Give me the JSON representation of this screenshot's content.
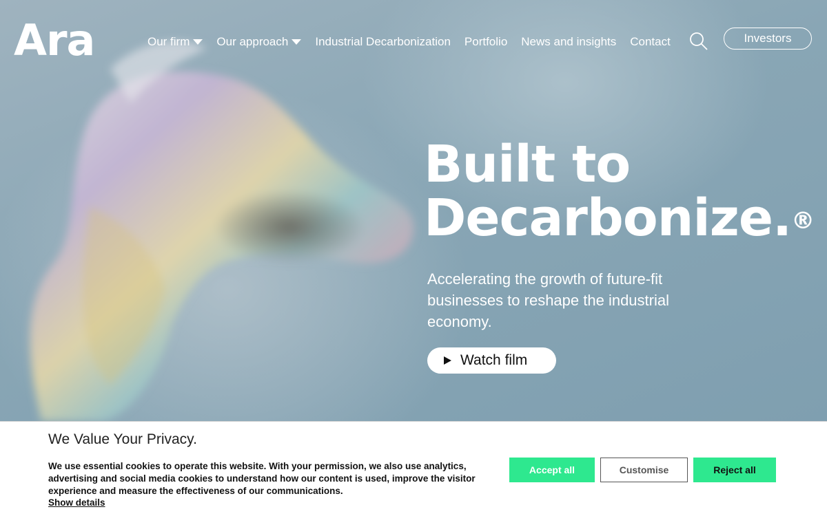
{
  "brand": {
    "logo_text": "Ara"
  },
  "nav": {
    "items": [
      {
        "label": "Our firm",
        "has_dropdown": true
      },
      {
        "label": "Our approach",
        "has_dropdown": true
      },
      {
        "label": "Industrial Decarbonization",
        "has_dropdown": false
      },
      {
        "label": "Portfolio",
        "has_dropdown": false
      },
      {
        "label": "News and insights",
        "has_dropdown": false
      },
      {
        "label": "Contact",
        "has_dropdown": false
      }
    ],
    "search_icon": "search-icon",
    "investors_label": "Investors"
  },
  "hero": {
    "headline_line1": "Built to",
    "headline_line2": "Decarbonize.",
    "registered_mark": "®",
    "subtitle": "Accelerating the growth of future-fit businesses to reshape the industrial economy.",
    "watch_label": "Watch film",
    "watch_icon": "play-icon"
  },
  "cookie": {
    "title": "We Value Your Privacy.",
    "body": "We use essential cookies to operate this website. With your permission, we also use analytics, advertising and social media cookies to understand how our content is used, improve the visitor experience and measure the effectiveness of our communications.",
    "details_link": "Show details",
    "accept_label": "Accept all",
    "customise_label": "Customise",
    "reject_label": "Reject all"
  },
  "colors": {
    "accent_green": "#2ee88f",
    "hero_bg": "#8fa8b5",
    "text_white": "#ffffff"
  }
}
